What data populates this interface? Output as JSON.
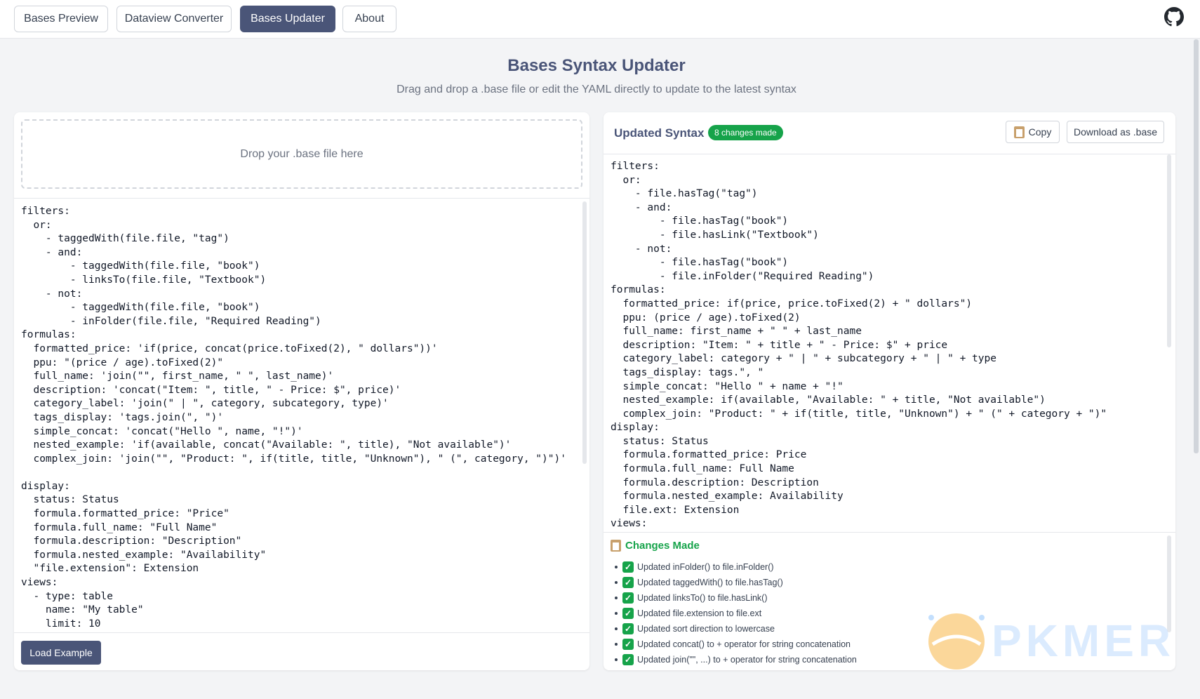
{
  "nav": {
    "tabs": [
      "Bases Preview",
      "Dataview Converter",
      "Bases Updater",
      "About"
    ],
    "github_icon": "github-icon"
  },
  "header": {
    "title": "Bases Syntax Updater",
    "subtitle": "Drag and drop a .base file or edit the YAML directly to update to the latest syntax"
  },
  "input": {
    "dropzone_text": "Drop your .base file here",
    "code": "filters:\n  or:\n    - taggedWith(file.file, \"tag\")\n    - and:\n        - taggedWith(file.file, \"book\")\n        - linksTo(file.file, \"Textbook\")\n    - not:\n        - taggedWith(file.file, \"book\")\n        - inFolder(file.file, \"Required Reading\")\nformulas:\n  formatted_price: 'if(price, concat(price.toFixed(2), \" dollars\"))'\n  ppu: \"(price / age).toFixed(2)\"\n  full_name: 'join(\"\", first_name, \" \", last_name)'\n  description: 'concat(\"Item: \", title, \" - Price: $\", price)'\n  category_label: 'join(\" | \", category, subcategory, type)'\n  tags_display: 'tags.join(\", \")'\n  simple_concat: 'concat(\"Hello \", name, \"!\")'\n  nested_example: 'if(available, concat(\"Available: \", title), \"Not available\")'\n  complex_join: 'join(\"\", \"Product: \", if(title, title, \"Unknown\"), \" (\", category, \")\")'\n\ndisplay:\n  status: Status\n  formula.formatted_price: \"Price\"\n  formula.full_name: \"Full Name\"\n  formula.description: \"Description\"\n  formula.nested_example: \"Availability\"\n  \"file.extension\": Extension\nviews:\n  - type: table\n    name: \"My table\"\n    limit: 10",
    "load_button": "Load Example"
  },
  "output": {
    "title": "Updated Syntax",
    "badge": "8 changes made",
    "copy_button": "Copy",
    "download_button": "Download as .base",
    "code": "filters:\n  or:\n    - file.hasTag(\"tag\")\n    - and:\n        - file.hasTag(\"book\")\n        - file.hasLink(\"Textbook\")\n    - not:\n        - file.hasTag(\"book\")\n        - file.inFolder(\"Required Reading\")\nformulas:\n  formatted_price: if(price, price.toFixed(2) + \" dollars\")\n  ppu: (price / age).toFixed(2)\n  full_name: first_name + \" \" + last_name\n  description: \"Item: \" + title + \" - Price: $\" + price\n  category_label: category + \" | \" + subcategory + \" | \" + type\n  tags_display: tags.\", \"\n  simple_concat: \"Hello \" + name + \"!\"\n  nested_example: if(available, \"Available: \" + title, \"Not available\")\n  complex_join: \"Product: \" + if(title, title, \"Unknown\") + \" (\" + category + \")\"\ndisplay:\n  status: Status\n  formula.formatted_price: Price\n  formula.full_name: Full Name\n  formula.description: Description\n  formula.nested_example: Availability\n  file.ext: Extension\nviews:"
  },
  "changes": {
    "title": "Changes Made",
    "items": [
      "Updated inFolder() to file.inFolder()",
      "Updated taggedWith() to file.hasTag()",
      "Updated linksTo() to file.hasLink()",
      "Updated file.extension to file.ext",
      "Updated sort direction to lowercase",
      "Updated concat() to + operator for string concatenation",
      "Updated join(\"\", ...) to + operator for string concatenation"
    ]
  },
  "watermark": {
    "text": "PKMER"
  }
}
